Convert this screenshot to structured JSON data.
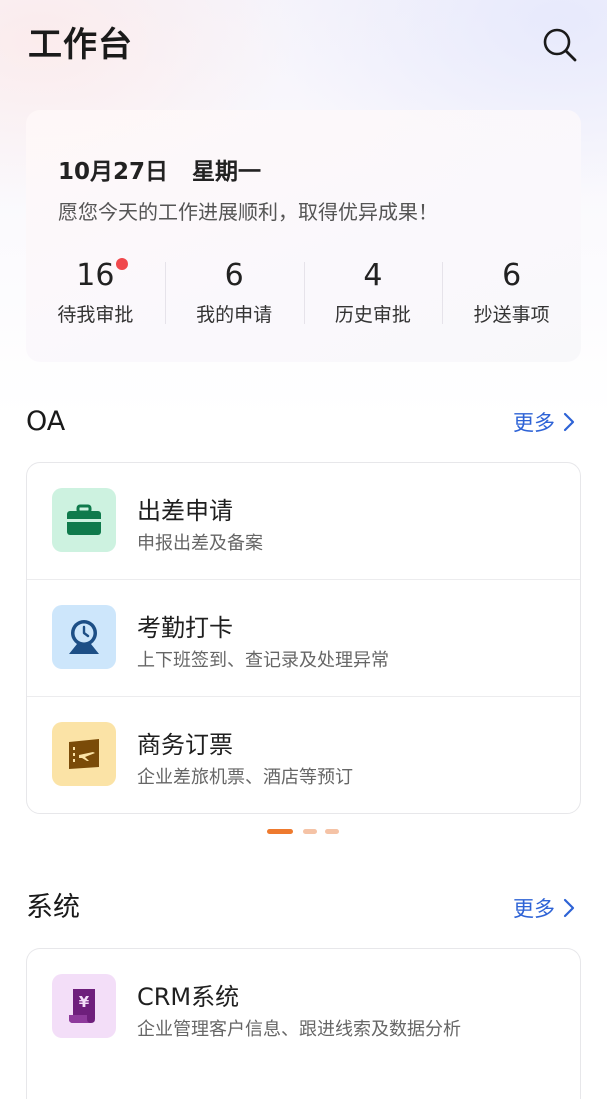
{
  "header": {
    "title": "工作台",
    "search_icon": "search-icon"
  },
  "summary": {
    "date": "10月27日",
    "weekday": "星期一",
    "greeting": "愿您今天的工作进展顺利，取得优异成果！",
    "stats": [
      {
        "value": "16",
        "label": "待我审批",
        "has_dot": true
      },
      {
        "value": "6",
        "label": "我的申请",
        "has_dot": false
      },
      {
        "value": "4",
        "label": "历史审批",
        "has_dot": false
      },
      {
        "value": "6",
        "label": "抄送事项",
        "has_dot": false
      }
    ]
  },
  "oa": {
    "title": "OA",
    "more_label": "更多",
    "items": [
      {
        "title": "出差申请",
        "desc": "申报出差及备案",
        "icon": "briefcase-icon",
        "tile_color": "#cdf2e0",
        "icon_color": "#0f7a4c"
      },
      {
        "title": "考勤打卡",
        "desc": "上下班签到、查记录及处理异常",
        "icon": "location-clock-icon",
        "tile_color": "#cde6fb",
        "icon_color": "#1d4f86"
      },
      {
        "title": "商务订票",
        "desc": "企业差旅机票、酒店等预订",
        "icon": "ticket-plane-icon",
        "tile_color": "#fbe3a6",
        "icon_color": "#7a4b08"
      }
    ],
    "pager": {
      "active_index": 0,
      "count": 3
    }
  },
  "system": {
    "title": "系统",
    "more_label": "更多",
    "items": [
      {
        "title": "CRM系统",
        "desc": "企业管理客户信息、跟进线索及数据分析",
        "icon": "yen-document-icon",
        "tile_color": "#f3def8",
        "icon_color": "#6e1f7c"
      }
    ]
  },
  "colors": {
    "accent": "#2e63d6",
    "badge": "#f0484c",
    "pager_active": "#ee7a2e",
    "pager_inactive": "#f5c3a6"
  }
}
